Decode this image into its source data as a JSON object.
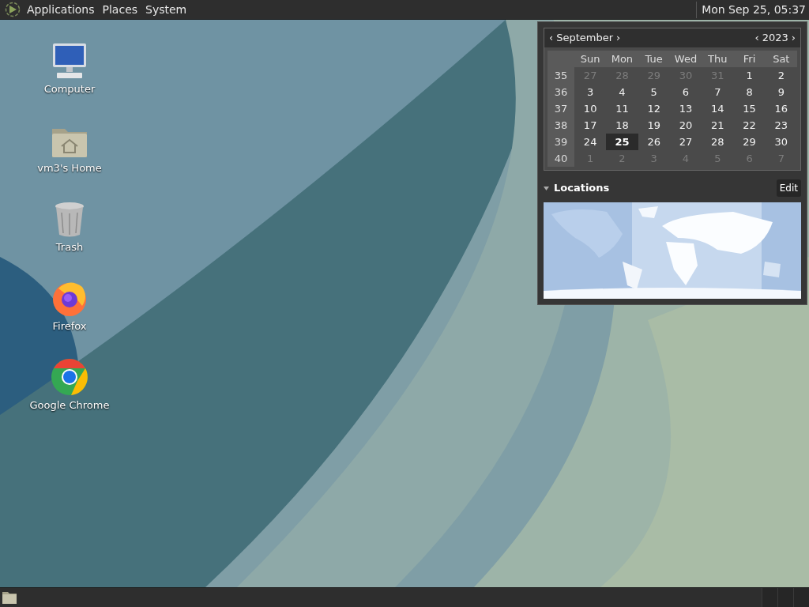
{
  "top_panel": {
    "menus": [
      {
        "label": "Applications"
      },
      {
        "label": "Places"
      },
      {
        "label": "System"
      }
    ],
    "clock": "Mon Sep 25, 05:37"
  },
  "desktop_icons": [
    {
      "kind": "computer",
      "label": "Computer"
    },
    {
      "kind": "home",
      "label": "vm3's Home"
    },
    {
      "kind": "trash",
      "label": "Trash"
    },
    {
      "kind": "firefox",
      "label": "Firefox"
    },
    {
      "kind": "chrome",
      "label": "Google Chrome"
    }
  ],
  "calendar": {
    "month": "September",
    "year": "2023",
    "prev_month": "‹",
    "next_month": "›",
    "prev_year": "‹",
    "next_year": "›",
    "weekdays": [
      "Sun",
      "Mon",
      "Tue",
      "Wed",
      "Thu",
      "Fri",
      "Sat"
    ],
    "weeks": [
      {
        "number": "35",
        "days": [
          {
            "label": "27",
            "other_month": true,
            "selected": false
          },
          {
            "label": "28",
            "other_month": true,
            "selected": false
          },
          {
            "label": "29",
            "other_month": true,
            "selected": false
          },
          {
            "label": "30",
            "other_month": true,
            "selected": false
          },
          {
            "label": "31",
            "other_month": true,
            "selected": false
          },
          {
            "label": "1",
            "other_month": false,
            "selected": false
          },
          {
            "label": "2",
            "other_month": false,
            "selected": false
          }
        ]
      },
      {
        "number": "36",
        "days": [
          {
            "label": "3",
            "other_month": false,
            "selected": false
          },
          {
            "label": "4",
            "other_month": false,
            "selected": false
          },
          {
            "label": "5",
            "other_month": false,
            "selected": false
          },
          {
            "label": "6",
            "other_month": false,
            "selected": false
          },
          {
            "label": "7",
            "other_month": false,
            "selected": false
          },
          {
            "label": "8",
            "other_month": false,
            "selected": false
          },
          {
            "label": "9",
            "other_month": false,
            "selected": false
          }
        ]
      },
      {
        "number": "37",
        "days": [
          {
            "label": "10",
            "other_month": false,
            "selected": false
          },
          {
            "label": "11",
            "other_month": false,
            "selected": false
          },
          {
            "label": "12",
            "other_month": false,
            "selected": false
          },
          {
            "label": "13",
            "other_month": false,
            "selected": false
          },
          {
            "label": "14",
            "other_month": false,
            "selected": false
          },
          {
            "label": "15",
            "other_month": false,
            "selected": false
          },
          {
            "label": "16",
            "other_month": false,
            "selected": false
          }
        ]
      },
      {
        "number": "38",
        "days": [
          {
            "label": "17",
            "other_month": false,
            "selected": false
          },
          {
            "label": "18",
            "other_month": false,
            "selected": false
          },
          {
            "label": "19",
            "other_month": false,
            "selected": false
          },
          {
            "label": "20",
            "other_month": false,
            "selected": false
          },
          {
            "label": "21",
            "other_month": false,
            "selected": false
          },
          {
            "label": "22",
            "other_month": false,
            "selected": false
          },
          {
            "label": "23",
            "other_month": false,
            "selected": false
          }
        ]
      },
      {
        "number": "39",
        "days": [
          {
            "label": "24",
            "other_month": false,
            "selected": false
          },
          {
            "label": "25",
            "other_month": false,
            "selected": true
          },
          {
            "label": "26",
            "other_month": false,
            "selected": false
          },
          {
            "label": "27",
            "other_month": false,
            "selected": false
          },
          {
            "label": "28",
            "other_month": false,
            "selected": false
          },
          {
            "label": "29",
            "other_month": false,
            "selected": false
          },
          {
            "label": "30",
            "other_month": false,
            "selected": false
          }
        ]
      },
      {
        "number": "40",
        "days": [
          {
            "label": "1",
            "other_month": true,
            "selected": false
          },
          {
            "label": "2",
            "other_month": true,
            "selected": false
          },
          {
            "label": "3",
            "other_month": true,
            "selected": false
          },
          {
            "label": "4",
            "other_month": true,
            "selected": false
          },
          {
            "label": "5",
            "other_month": true,
            "selected": false
          },
          {
            "label": "6",
            "other_month": true,
            "selected": false
          },
          {
            "label": "7",
            "other_month": true,
            "selected": false
          }
        ]
      }
    ]
  },
  "locations": {
    "title": "Locations",
    "expanded": true,
    "edit_button": "Edit"
  }
}
